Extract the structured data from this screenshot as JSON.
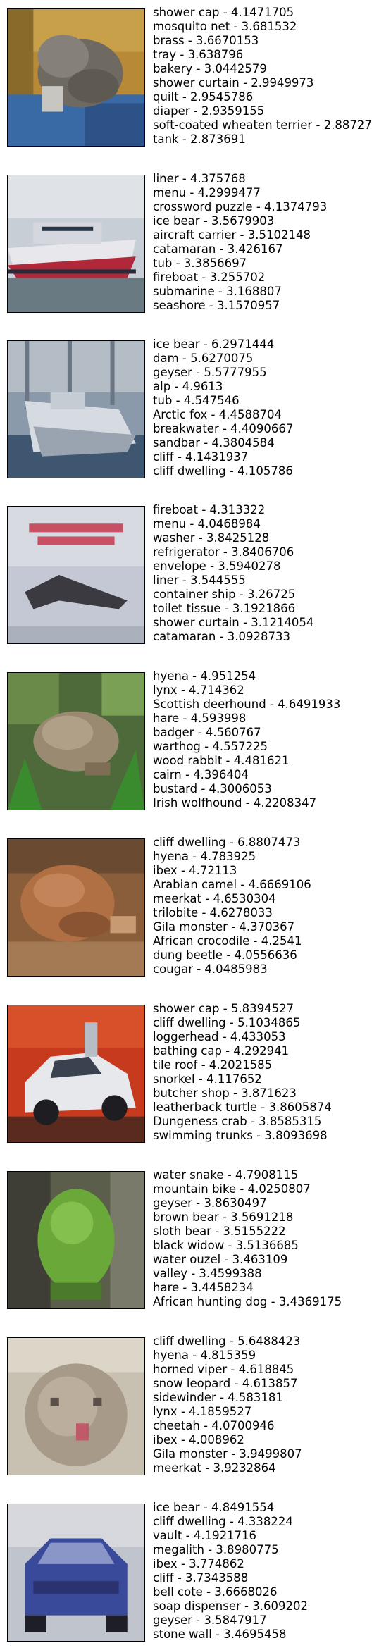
{
  "rows": [
    {
      "image": "cat lying on a blue cushion",
      "predictions": [
        "shower cap - 4.1471705",
        "mosquito net - 3.681532",
        "brass - 3.6670153",
        "tray - 3.638796",
        "bakery - 3.0442579",
        "shower curtain - 2.9949973",
        "quilt - 2.9545786",
        "diaper - 2.9359155",
        "soft-coated wheaten terrier - 2.88727",
        "tank - 2.873691"
      ]
    },
    {
      "image": "ferry boat on water",
      "predictions": [
        "liner - 4.375768",
        "menu - 4.2999477",
        "crossword puzzle - 4.1374793",
        "ice bear - 3.5679903",
        "aircraft carrier - 3.5102148",
        "catamaran - 3.426167",
        "tub - 3.3856697",
        "fireboat - 3.255702",
        "submarine - 3.168807",
        "seashore - 3.1570957"
      ]
    },
    {
      "image": "boat in harbor",
      "predictions": [
        "ice bear - 6.2971444",
        "dam - 5.6270075",
        "geyser - 5.5777955",
        "alp - 4.9613",
        "tub - 4.547546",
        "Arctic fox - 4.4588704",
        "breakwater - 4.4090667",
        "sandbar - 4.3804584",
        "cliff - 4.1431937",
        "cliff dwelling - 4.105786"
      ]
    },
    {
      "image": "airplane poster",
      "predictions": [
        "fireboat - 4.313322",
        "menu - 4.0468984",
        "washer - 3.8425128",
        "refrigerator - 3.8406706",
        "envelope - 3.5940278",
        "liner - 3.544555",
        "container ship - 3.26725",
        "toilet tissue - 3.1921866",
        "shower curtain - 3.1214054",
        "catamaran - 3.0928733"
      ]
    },
    {
      "image": "frog in grass",
      "predictions": [
        "hyena - 4.951254",
        "lynx - 4.714362",
        "Scottish deerhound - 4.6491933",
        "hare - 4.593998",
        "badger - 4.560767",
        "warthog - 4.557225",
        "wood rabbit - 4.481621",
        "cairn - 4.396404",
        "bustard - 4.3006053",
        "Irish wolfhound - 4.2208347"
      ]
    },
    {
      "image": "toad on brown ground",
      "predictions": [
        "cliff dwelling - 6.8807473",
        "hyena - 4.783925",
        "ibex - 4.72113",
        "Arabian camel - 4.6669106",
        "meerkat - 4.6530304",
        "trilobite - 4.6278033",
        "Gila monster - 4.370367",
        "African crocodile - 4.2541",
        "dung beetle - 4.0556636",
        "cougar - 4.0485983"
      ]
    },
    {
      "image": "white car on red background",
      "predictions": [
        "shower cap - 5.8394527",
        "cliff dwelling - 5.1034865",
        "loggerhead - 4.433053",
        "bathing cap - 4.292941",
        "tile roof - 4.2021585",
        "snorkel - 4.117652",
        "butcher shop - 3.871623",
        "leatherback turtle - 3.8605874",
        "Dungeness crab - 3.8585315",
        "swimming trunks - 3.8093698"
      ]
    },
    {
      "image": "green frog",
      "predictions": [
        "water snake - 4.7908115",
        "mountain bike - 4.0250807",
        "geyser - 3.8630497",
        "brown bear - 3.5691218",
        "sloth bear - 3.5155222",
        "black widow - 3.5136685",
        "water ouzel - 3.463109",
        "valley - 3.4599388",
        "hare - 3.4458234",
        "African hunting dog - 3.4369175"
      ]
    },
    {
      "image": "cat face close-up",
      "predictions": [
        "cliff dwelling - 5.6488423",
        "hyena - 4.815359",
        "horned viper - 4.618845",
        "snow leopard - 4.613857",
        "sidewinder - 4.583181",
        "lynx - 4.1859527",
        "cheetah - 4.0700946",
        "ibex - 4.008962",
        "Gila monster - 3.9499807",
        "meerkat - 3.9232864"
      ]
    },
    {
      "image": "blue car",
      "predictions": [
        "ice bear - 4.8491554",
        "cliff dwelling - 4.338224",
        "vault - 4.1921716",
        "megalith - 3.8980775",
        "ibex - 3.774862",
        "cliff - 3.7343588",
        "bell cote - 3.6668026",
        "soap dispenser - 3.609202",
        "geyser - 3.5847917",
        "stone wall - 3.4695458"
      ]
    }
  ]
}
